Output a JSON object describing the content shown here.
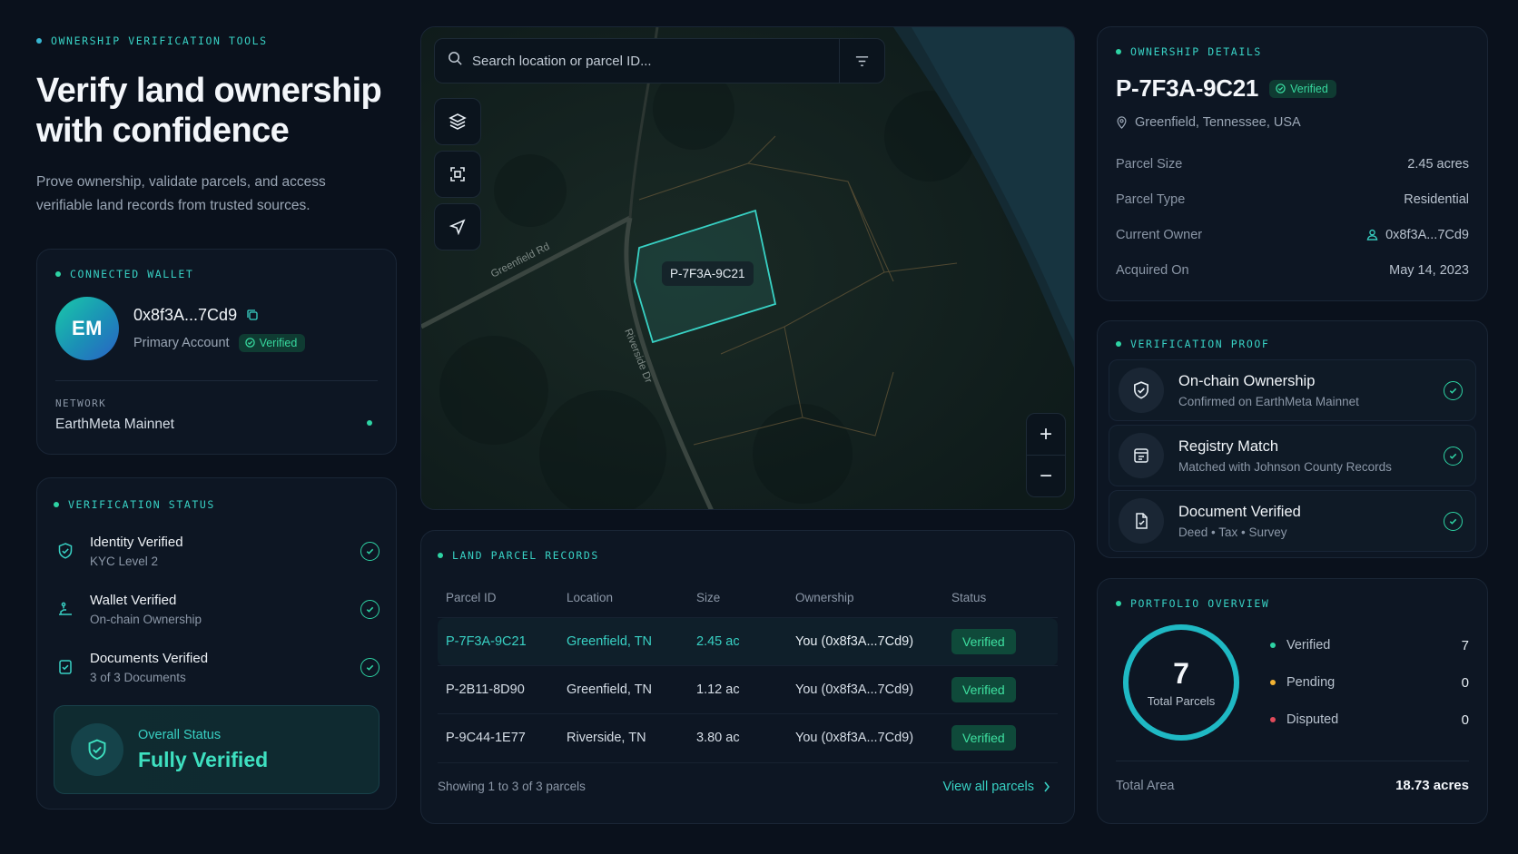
{
  "hero": {
    "eyebrow": "OWNERSHIP VERIFICATION TOOLS",
    "title_line1": "Verify land ownership",
    "title_line2": "with confidence",
    "subtitle_line1": "Prove ownership, validate parcels, and access",
    "subtitle_line2": "verifiable land records from trusted sources."
  },
  "wallet": {
    "label": "CONNECTED WALLET",
    "initials": "EM",
    "address": "0x8f3A...7Cd9",
    "account": "Primary Account",
    "badge": "Verified",
    "network_label": "NETWORK",
    "network_value": "EarthMeta Mainnet"
  },
  "verification_status": {
    "label": "VERIFICATION STATUS",
    "items": [
      {
        "title": "Identity Verified",
        "sub": "KYC Level 2"
      },
      {
        "title": "Wallet Verified",
        "sub": "On-chain Ownership"
      },
      {
        "title": "Documents Verified",
        "sub": "3 of 3 Documents"
      }
    ],
    "overall_label": "Overall Status",
    "overall_value": "Fully Verified"
  },
  "map": {
    "search_placeholder": "Search location or parcel ID...",
    "parcel_label": "P-7F3A-9C21",
    "road1": "Greenfield Rd",
    "road2": "Riverside Dr",
    "zoom_in": "+",
    "zoom_out": "−"
  },
  "records": {
    "label": "LAND PARCEL RECORDS",
    "columns": [
      "Parcel ID",
      "Location",
      "Size",
      "Ownership",
      "Status"
    ],
    "rows": [
      {
        "id": "P-7F3A-9C21",
        "location": "Greenfield, TN",
        "size": "2.45 ac",
        "owner": "You (0x8f3A...7Cd9)",
        "status": "Verified"
      },
      {
        "id": "P-2B11-8D90",
        "location": "Greenfield, TN",
        "size": "1.12 ac",
        "owner": "You (0x8f3A...7Cd9)",
        "status": "Verified"
      },
      {
        "id": "P-9C44-1E77",
        "location": "Riverside, TN",
        "size": "3.80 ac",
        "owner": "You (0x8f3A...7Cd9)",
        "status": "Verified"
      }
    ],
    "showing": "Showing 1 to 3 of 3 parcels",
    "view_all": "View all parcels"
  },
  "details": {
    "label": "OWNERSHIP DETAILS",
    "parcel_id": "P-7F3A-9C21",
    "badge": "Verified",
    "location": "Greenfield, Tennessee, USA",
    "rows": [
      {
        "key": "Parcel Size",
        "value": "2.45 acres"
      },
      {
        "key": "Parcel Type",
        "value": "Residential"
      },
      {
        "key": "Current Owner",
        "value": "0x8f3A...7Cd9"
      },
      {
        "key": "Acquired On",
        "value": "May 14, 2023"
      }
    ]
  },
  "proof": {
    "label": "VERIFICATION PROOF",
    "items": [
      {
        "title": "On-chain Ownership",
        "sub": "Confirmed on EarthMeta Mainnet"
      },
      {
        "title": "Registry Match",
        "sub": "Matched with Johnson County Records"
      },
      {
        "title": "Document Verified",
        "sub": "Deed • Tax • Survey"
      }
    ]
  },
  "portfolio": {
    "label": "PORTFOLIO OVERVIEW",
    "total": "7",
    "total_label": "Total Parcels",
    "legend": [
      {
        "name": "Verified",
        "value": "7",
        "color": "#2ed3a4"
      },
      {
        "name": "Pending",
        "value": "0",
        "color": "#f2b233"
      },
      {
        "name": "Disputed",
        "value": "0",
        "color": "#e04a5a"
      }
    ],
    "area_label": "Total Area",
    "area_value": "18.73 acres"
  },
  "colors": {
    "accent": "#38d1c4",
    "success": "#2ed3a4",
    "background": "#0a111c"
  }
}
